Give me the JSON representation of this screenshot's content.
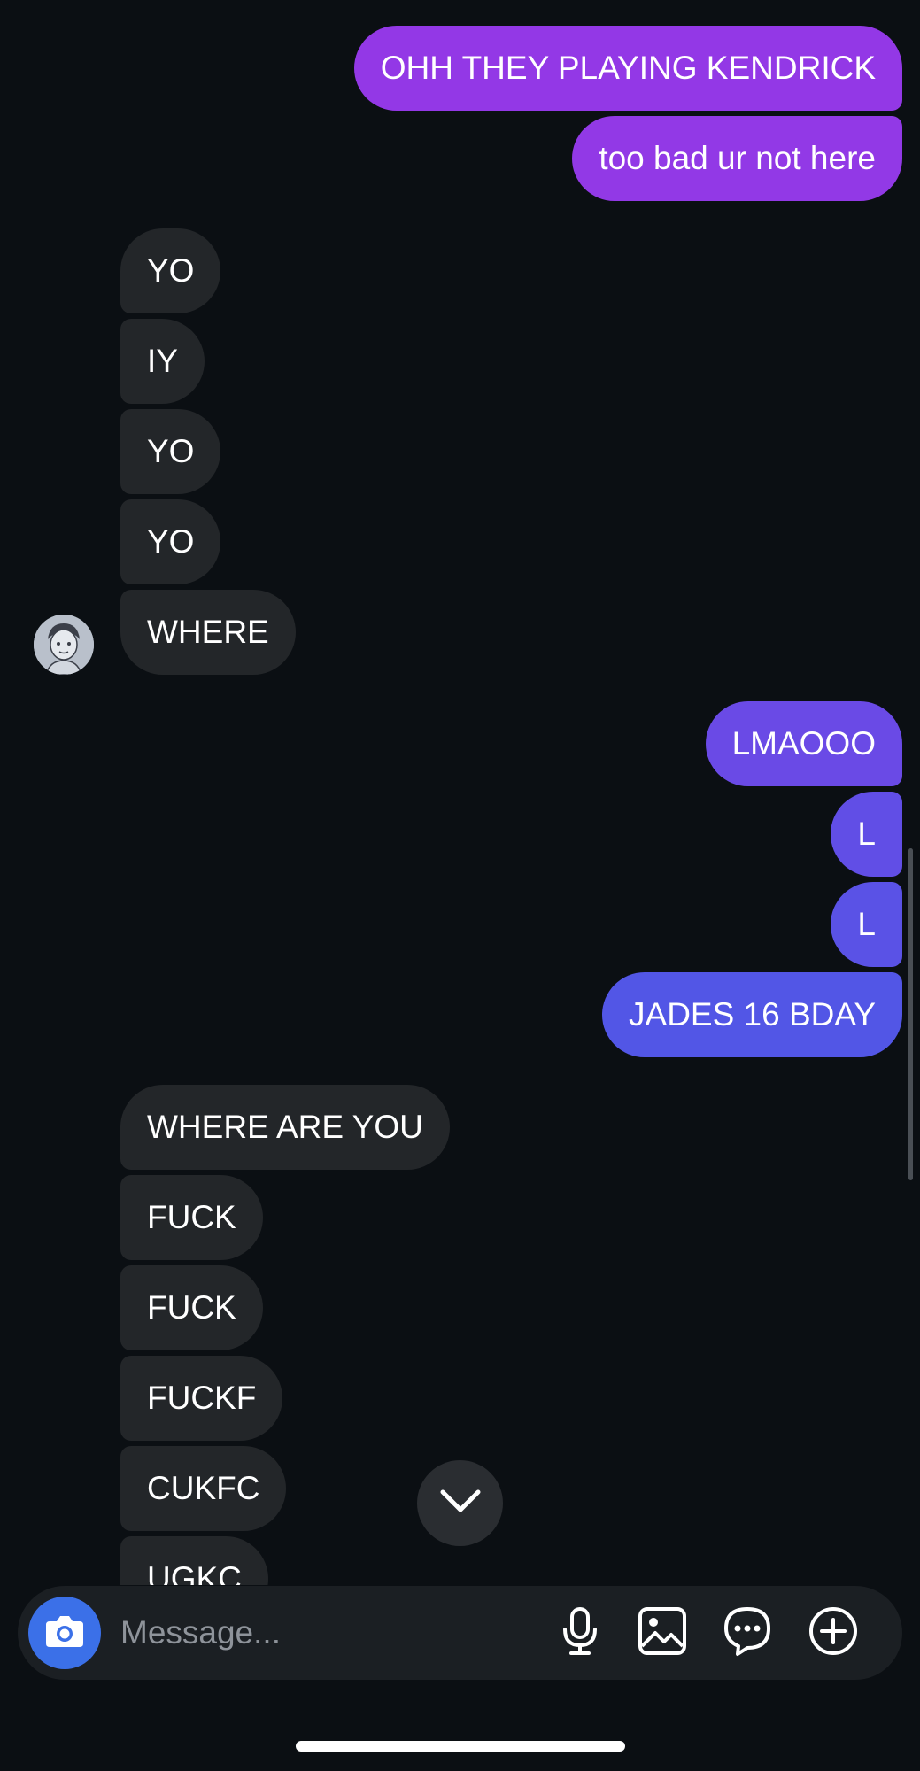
{
  "colors": {
    "background": "#0b0f13",
    "incoming_bubble": "#232629",
    "outgoing_gradient_top": "#9438e6",
    "outgoing_gradient_bottom": "#4f5ee6",
    "camera_button": "#3b70e8"
  },
  "messages": [
    {
      "sender": "me",
      "text": "OHH THEY PLAYING KENDRICK"
    },
    {
      "sender": "me",
      "text": "too bad ur not here"
    },
    {
      "sender": "them",
      "text": "YO"
    },
    {
      "sender": "them",
      "text": "IY"
    },
    {
      "sender": "them",
      "text": "YO"
    },
    {
      "sender": "them",
      "text": "YO"
    },
    {
      "sender": "them",
      "text": "WHERE"
    },
    {
      "sender": "me",
      "text": "LMAOOO"
    },
    {
      "sender": "me",
      "text": "L"
    },
    {
      "sender": "me",
      "text": "L"
    },
    {
      "sender": "me",
      "text": "JADES 16 BDAY"
    },
    {
      "sender": "them",
      "text": "WHERE ARE YOU"
    },
    {
      "sender": "them",
      "text": "FUCK"
    },
    {
      "sender": "them",
      "text": "FUCK"
    },
    {
      "sender": "them",
      "text": "FUCKF"
    },
    {
      "sender": "them",
      "text": "CUKFC"
    },
    {
      "sender": "them",
      "text": "UGKC"
    }
  ],
  "composer": {
    "placeholder": "Message...",
    "value": "",
    "icons": [
      "camera-icon",
      "microphone-icon",
      "image-icon",
      "chat-bubble-icon",
      "plus-circle-icon"
    ]
  },
  "icons": {
    "jump_to_latest": "chevron-down-icon",
    "avatar": "contact-avatar"
  }
}
